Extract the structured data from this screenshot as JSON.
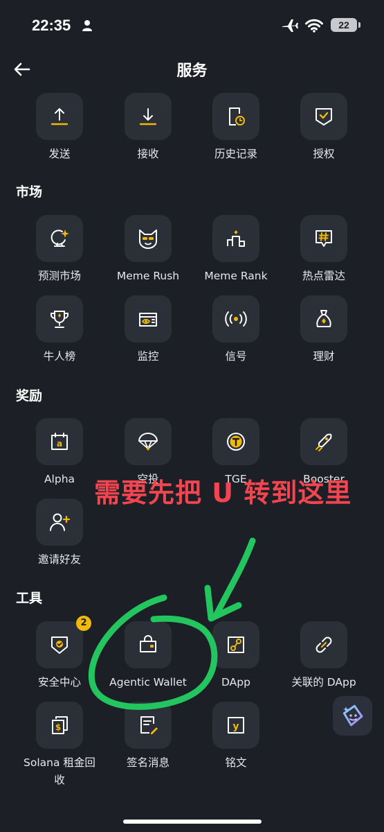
{
  "status_bar": {
    "time": "22:35",
    "battery": "22"
  },
  "header": {
    "title": "服务"
  },
  "services": [
    {
      "label": "发送",
      "icon": "upload-icon"
    },
    {
      "label": "接收",
      "icon": "download-icon"
    },
    {
      "label": "历史记录",
      "icon": "history-icon"
    },
    {
      "label": "授权",
      "icon": "authorize-icon"
    }
  ],
  "market": {
    "title": "市场",
    "items": [
      {
        "label": "预测市场",
        "icon": "crystal-ball-icon"
      },
      {
        "label": "Meme Rush",
        "icon": "meme-face-icon"
      },
      {
        "label": "Meme Rank",
        "icon": "podium-icon"
      },
      {
        "label": "热点雷达",
        "icon": "hashtag-icon"
      },
      {
        "label": "牛人榜",
        "icon": "trophy-icon"
      },
      {
        "label": "监控",
        "icon": "monitor-eye-icon"
      },
      {
        "label": "信号",
        "icon": "signal-icon"
      },
      {
        "label": "理财",
        "icon": "money-bag-icon"
      }
    ]
  },
  "rewards": {
    "title": "奖励",
    "items": [
      {
        "label": "Alpha",
        "icon": "alpha-calendar-icon"
      },
      {
        "label": "空投",
        "icon": "parachute-icon"
      },
      {
        "label": "TGE",
        "icon": "tge-coin-icon"
      },
      {
        "label": "Booster",
        "icon": "rocket-icon"
      },
      {
        "label": "邀请好友",
        "icon": "invite-user-icon"
      }
    ]
  },
  "tools": {
    "title": "工具",
    "items": [
      {
        "label": "安全中心",
        "icon": "security-shield-icon",
        "badge": "2"
      },
      {
        "label": "Agentic Wallet",
        "icon": "wallet-icon"
      },
      {
        "label": "DApp",
        "icon": "dapp-icon"
      },
      {
        "label": "关联的 DApp",
        "icon": "link-icon"
      },
      {
        "label": "Solana 租金回收",
        "label_line1": "Solana 租金回",
        "label_line2": "收",
        "icon": "rent-recovery-icon"
      },
      {
        "label": "签名消息",
        "icon": "sign-message-icon"
      },
      {
        "label": "铭文",
        "icon": "inscription-icon"
      }
    ]
  },
  "annotation": {
    "text": "需要先把 U 转到这里",
    "color": "#f2454f",
    "stroke_color": "#22c55e"
  },
  "colors": {
    "background": "#1c1f26",
    "tile": "#2b2f37",
    "accent": "#f0b90b"
  }
}
